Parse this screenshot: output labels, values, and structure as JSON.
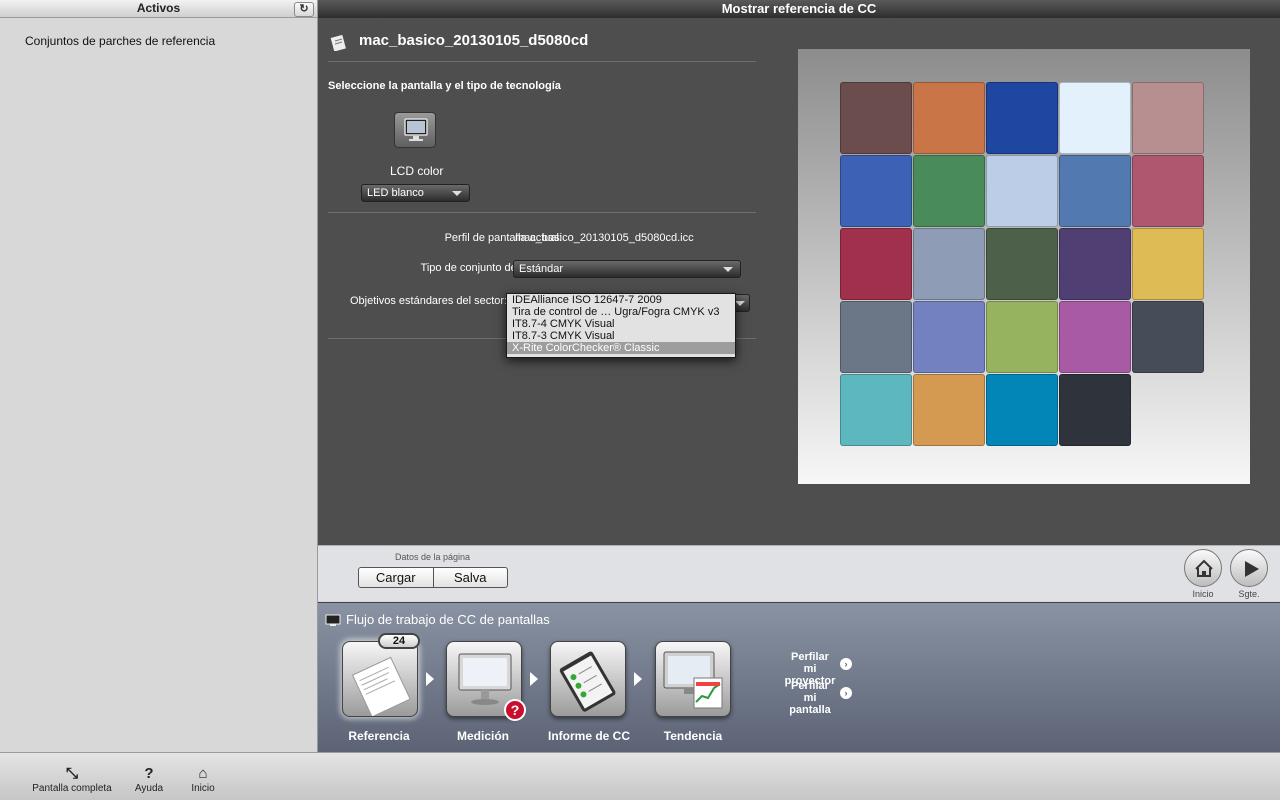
{
  "left_panel": {
    "header": "Activos",
    "refresh_icon": "refresh-icon",
    "items": [
      "Conjuntos de parches de referencia"
    ]
  },
  "window": {
    "title": "Mostrar referencia de CC"
  },
  "main": {
    "profile_name": "mac_basico_20130105_d5080cd",
    "section_label": "Seleccione la pantalla y el tipo de tecnología",
    "display_type": "LCD color",
    "backlight": {
      "selected": "LED blanco"
    },
    "current_profile_label": "Perfil de pantalla actual:",
    "current_profile_value": "mac_basico_20130105_d5080cd.icc",
    "patch_set_label": "Tipo de conjunto de parches:",
    "patch_set_value": "Estándar",
    "industry_label": "Objetivos estándares del sector:",
    "industry_options": [
      "IDEAlliance ISO 12647-7 2009",
      "Tira de control de … Ugra/Fogra CMYK v3",
      "IT8.7-4 CMYK Visual",
      "IT8.7-3 CMYK Visual",
      "X-Rite ColorChecker® Classic"
    ],
    "industry_selected_index": 4
  },
  "checker": {
    "rows": [
      [
        "#6a4d4c",
        "#c97548",
        "#1f46a1",
        "#e3f1fd",
        "#b78f91"
      ],
      [
        "#3c61b5",
        "#4a8b5a",
        "#bccde7",
        "#537ab0",
        "#b05770"
      ],
      [
        "#a0304b",
        "#8f9cb5",
        "#4d6049",
        "#4f3f73",
        "#dfbb55"
      ],
      [
        "#6b7686",
        "#7481c1",
        "#96b45f",
        "#a85aa4",
        "#474c59"
      ],
      [
        "#5cb8be",
        "#d49a51",
        "#0285b7",
        "#2f333c"
      ]
    ]
  },
  "page_data": {
    "label": "Datos de la página",
    "load": "Cargar",
    "save": "Salva",
    "home": "Inicio",
    "next": "Sgte."
  },
  "workflow": {
    "title": "Flujo de trabajo de CC de pantallas",
    "badge_count": "24",
    "steps": [
      "Referencia",
      "Medición",
      "Informe de CC",
      "Tendencia"
    ],
    "links": [
      "Perfilar mi proyector",
      "Perfilar mi pantalla"
    ]
  },
  "toolbar": {
    "fullscreen": "Pantalla completa",
    "help": "Ayuda",
    "home": "Inicio"
  }
}
